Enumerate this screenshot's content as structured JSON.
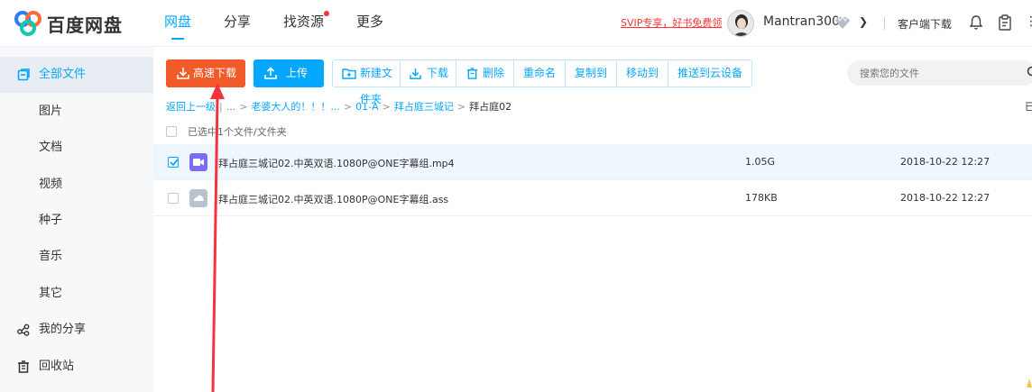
{
  "logo": {
    "text": "百度网盘",
    "colors": [
      "#2f7cf6",
      "#ff6a3d",
      "#14c6b3"
    ]
  },
  "nav": {
    "items": [
      {
        "label": "网盘",
        "active": true
      },
      {
        "label": "分享",
        "active": false
      },
      {
        "label": "找资源",
        "active": false,
        "dot": true
      },
      {
        "label": "更多",
        "active": false
      }
    ]
  },
  "header": {
    "svip_promo": "SVIP专享，好书免费领",
    "username": "Mantran300",
    "client_download": "客户端下载"
  },
  "sidebar": {
    "items": [
      {
        "label": "全部文件",
        "icon": "folder-icon",
        "active": true
      },
      {
        "label": "图片"
      },
      {
        "label": "文档"
      },
      {
        "label": "视频"
      },
      {
        "label": "种子"
      },
      {
        "label": "音乐"
      },
      {
        "label": "其它"
      },
      {
        "label": "我的分享",
        "icon": "share-icon"
      },
      {
        "label": "回收站",
        "icon": "trash-icon"
      }
    ]
  },
  "toolbar": {
    "fast_download": "高速下载",
    "upload": "上传",
    "new_folder": "新建文件夹",
    "download": "下载",
    "delete": "删除",
    "rename": "重命名",
    "copy_to": "复制到",
    "move_to": "移动到",
    "push_to_cloud": "推送到云设备"
  },
  "search": {
    "placeholder": "搜索您的文件"
  },
  "breadcrumb": {
    "back": "返回上一级",
    "items": [
      "...",
      "老婆大人的！！！...",
      "01-A",
      "拜占庭三城记"
    ],
    "current": "拜占庭02",
    "right_label": "已"
  },
  "selection": {
    "text": "已选中1个文件/文件夹"
  },
  "files": [
    {
      "name": "拜占庭三城记02.中英双语.1080P@ONE字幕组.mp4",
      "size": "1.05G",
      "time": "2018-10-22 12:27",
      "type": "video",
      "selected": true
    },
    {
      "name": "拜占庭三城记02.中英双语.1080P@ONE字幕组.ass",
      "size": "178KB",
      "time": "2018-10-22 12:27",
      "type": "file",
      "selected": false
    }
  ],
  "colors": {
    "accent": "#06a7ff",
    "fast_download": "#f25a2a",
    "arrow": "#f4333f"
  }
}
